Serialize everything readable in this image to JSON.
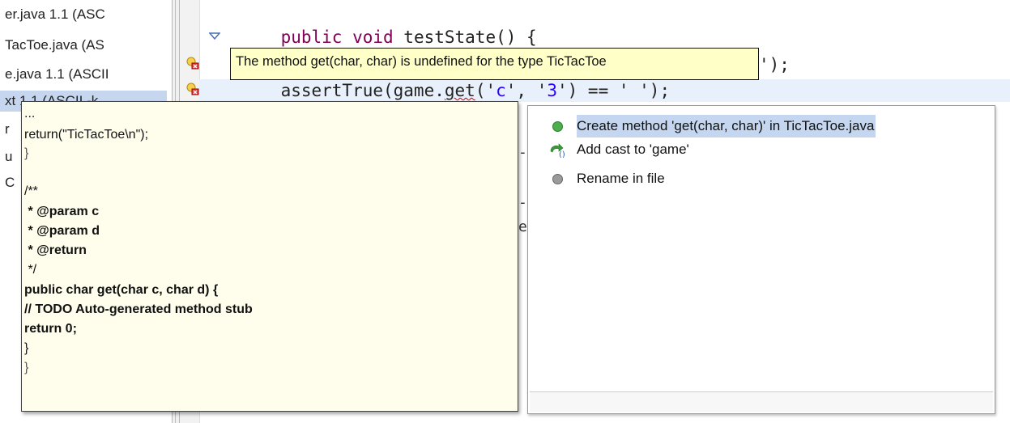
{
  "files": [
    {
      "label": "er.java  1.1  (ASC",
      "selected": false
    },
    {
      "label": "TacToe.java   (AS",
      "selected": false
    },
    {
      "label": "e.java  1.1  (ASCII",
      "selected": false
    },
    {
      "label": "xt  1.1  (ASCII -k",
      "selected": true
    },
    {
      "label": "r",
      "selected": false
    },
    {
      "label": "u",
      "selected": false
    },
    {
      "label": "C",
      "selected": false
    }
  ],
  "editor": {
    "line1": {
      "indent": "    ",
      "kw": "public void",
      "name": " testState() {"
    },
    "line2_tail": "');",
    "line3": {
      "pre": "    assertTrue(game.",
      "err": "get",
      "post": "('",
      "s1": "c",
      "mid": "', '",
      "s2": "3",
      "post2": "') == '",
      "post3": " ');"
    },
    "stray": [
      {
        "text": "-"
      },
      {
        "text": "-"
      },
      {
        "text": "e"
      }
    ]
  },
  "tooltip": {
    "text": "The method get(char, char) is undefined for the type TicTacToe"
  },
  "preview": {
    "lines": [
      {
        "text": "...",
        "bold": false
      },
      {
        "text": "return(\"TicTacToe\\n\");",
        "bold": false
      },
      {
        "text": "}",
        "bold": false
      },
      {
        "text": "",
        "bold": false
      },
      {
        "text": "/**",
        "bold": false
      },
      {
        "text": " * @param c",
        "bold": true
      },
      {
        "text": " * @param d",
        "bold": true
      },
      {
        "text": " * @return",
        "bold": true
      },
      {
        "text": " */",
        "bold": false
      },
      {
        "text": "public char get(char c, char d) {",
        "bold": true
      },
      {
        "text": "// TODO Auto-generated method stub",
        "bold": true
      },
      {
        "text": "return 0;",
        "bold": true
      },
      {
        "text": "}",
        "bold": false
      },
      {
        "text": "}",
        "bold": false
      }
    ]
  },
  "quickfix": {
    "proposals": [
      {
        "label": "Create method 'get(char, char)' in TicTacToe.java",
        "icon": "green-method-icon",
        "selected": true
      },
      {
        "label": "Add cast to 'game'",
        "icon": "cast-arrow-icon",
        "selected": false
      },
      {
        "label": "Rename in file",
        "icon": "grey-bullet-icon",
        "selected": false
      }
    ]
  },
  "colors": {
    "keyword": "#7f0055",
    "string": "#2a00ff",
    "tooltip_bg": "#ffffc8",
    "preview_bg": "#fffeec",
    "selection": "#c5d7f0"
  }
}
